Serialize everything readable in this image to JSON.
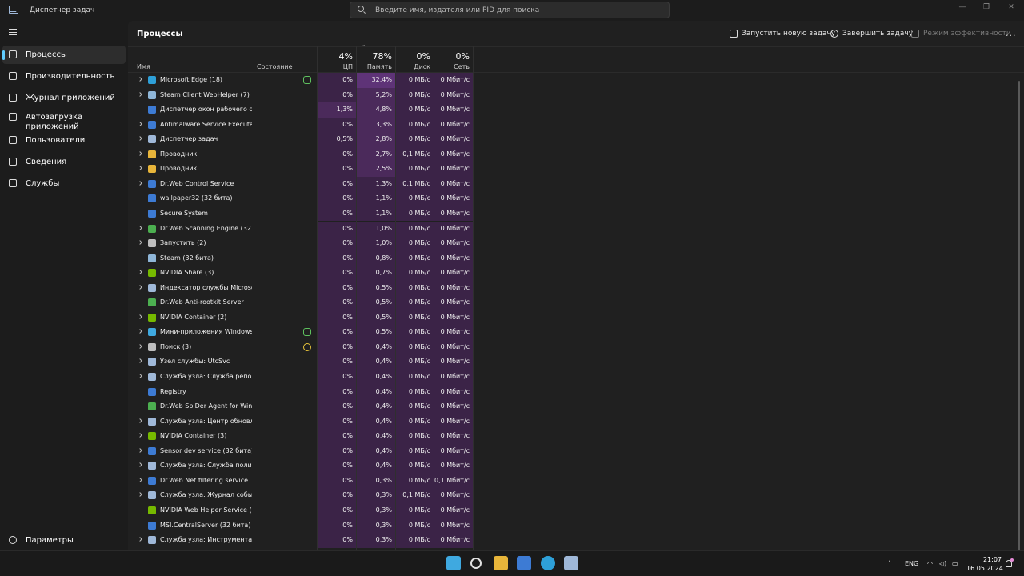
{
  "window": {
    "title": "Диспетчер задач"
  },
  "search": {
    "placeholder": "Введите имя, издателя или PID для поиска"
  },
  "sidebar": {
    "items": [
      {
        "label": "Процессы",
        "icon": "processes-icon",
        "active": true
      },
      {
        "label": "Производительность",
        "icon": "performance-icon",
        "active": false
      },
      {
        "label": "Журнал приложений",
        "icon": "app-history-icon",
        "active": false
      },
      {
        "label": "Автозагрузка приложений",
        "icon": "startup-apps-icon",
        "active": false
      },
      {
        "label": "Пользователи",
        "icon": "users-icon",
        "active": false
      },
      {
        "label": "Сведения",
        "icon": "details-icon",
        "active": false
      },
      {
        "label": "Службы",
        "icon": "services-icon",
        "active": false
      }
    ],
    "settings_label": "Параметры"
  },
  "toolbar": {
    "page_title": "Процессы",
    "run_task": "Запустить новую задачу",
    "end_task": "Завершить задачу",
    "efficiency": "Режим эффективности",
    "more": "..."
  },
  "columns": {
    "name": "Имя",
    "status": "Состояние",
    "cpu_pct": "4%",
    "cpu": "ЦП",
    "mem_pct": "78%",
    "mem": "Память",
    "disk_pct": "0%",
    "disk": "Диск",
    "net_pct": "0%",
    "net": "Сеть"
  },
  "colors": {
    "accent": "#60cdff",
    "heat_low": "#3b2347",
    "heat_mid": "#4b2a5b",
    "heat_high": "#5e3377",
    "status_green": "#5ec05e",
    "status_yellow": "#e7c33a"
  },
  "processes": [
    {
      "name": "Microsoft Edge (18)",
      "expand": true,
      "icon": "edge-icon",
      "iconColor": "#2ea0d8",
      "status": "leaf",
      "cpu": "0%",
      "mem": "32,4%",
      "disk": "0 МБ/с",
      "net": "0 Мбит/с",
      "cpuHeat": 0,
      "memHeat": 3
    },
    {
      "name": "Steam Client WebHelper (7)",
      "expand": true,
      "icon": "steam-icon",
      "iconColor": "#8fb6d8",
      "status": "",
      "cpu": "0%",
      "mem": "5,2%",
      "disk": "0 МБ/с",
      "net": "0 Мбит/с",
      "cpuHeat": 0,
      "memHeat": 2
    },
    {
      "name": "Диспетчер окон рабочего ст...",
      "expand": false,
      "icon": "window-manager-icon",
      "iconColor": "#3d7bd4",
      "status": "",
      "cpu": "1,3%",
      "mem": "4,8%",
      "disk": "0 МБ/с",
      "net": "0 Мбит/с",
      "cpuHeat": 2,
      "memHeat": 2
    },
    {
      "name": "Antimalware Service Executable",
      "expand": true,
      "icon": "defender-icon",
      "iconColor": "#3d7bd4",
      "status": "",
      "cpu": "0%",
      "mem": "3,3%",
      "disk": "0 МБ/с",
      "net": "0 Мбит/с",
      "cpuHeat": 0,
      "memHeat": 2
    },
    {
      "name": "Диспетчер задач",
      "expand": true,
      "icon": "task-manager-icon",
      "iconColor": "#9fb8d8",
      "status": "",
      "cpu": "0,5%",
      "mem": "2,8%",
      "disk": "0 МБ/с",
      "net": "0 Мбит/с",
      "cpuHeat": 1,
      "memHeat": 2
    },
    {
      "name": "Проводник",
      "expand": true,
      "icon": "folder-icon",
      "iconColor": "#e8b53a",
      "status": "",
      "cpu": "0%",
      "mem": "2,7%",
      "disk": "0,1 МБ/с",
      "net": "0 Мбит/с",
      "cpuHeat": 0,
      "memHeat": 2
    },
    {
      "name": "Проводник",
      "expand": true,
      "icon": "folder-icon",
      "iconColor": "#e8b53a",
      "status": "",
      "cpu": "0%",
      "mem": "2,5%",
      "disk": "0 МБ/с",
      "net": "0 Мбит/с",
      "cpuHeat": 0,
      "memHeat": 2
    },
    {
      "name": "Dr.Web Control Service",
      "expand": true,
      "icon": "service-icon",
      "iconColor": "#3d7bd4",
      "status": "",
      "cpu": "0%",
      "mem": "1,3%",
      "disk": "0,1 МБ/с",
      "net": "0 Мбит/с",
      "cpuHeat": 0,
      "memHeat": 1
    },
    {
      "name": "wallpaper32 (32 бита)",
      "expand": false,
      "icon": "wallpaper-icon",
      "iconColor": "#3d7bd4",
      "status": "",
      "cpu": "0%",
      "mem": "1,1%",
      "disk": "0 МБ/с",
      "net": "0 Мбит/с",
      "cpuHeat": 0,
      "memHeat": 1
    },
    {
      "name": "Secure System",
      "expand": false,
      "icon": "service-icon",
      "iconColor": "#3d7bd4",
      "status": "",
      "cpu": "0%",
      "mem": "1,1%",
      "disk": "0 МБ/с",
      "net": "0 Мбит/с",
      "cpuHeat": 0,
      "memHeat": 1
    },
    {
      "name": "Dr.Web Scanning Engine (32 б...",
      "expand": true,
      "icon": "drweb-icon",
      "iconColor": "#4caf50",
      "status": "",
      "cpu": "0%",
      "mem": "1,0%",
      "disk": "0 МБ/с",
      "net": "0 Мбит/с",
      "cpuHeat": 0,
      "memHeat": 1
    },
    {
      "name": "Запустить (2)",
      "expand": true,
      "icon": "run-icon",
      "iconColor": "#bdbdbd",
      "status": "",
      "cpu": "0%",
      "mem": "1,0%",
      "disk": "0 МБ/с",
      "net": "0 Мбит/с",
      "cpuHeat": 0,
      "memHeat": 1
    },
    {
      "name": "Steam (32 бита)",
      "expand": false,
      "icon": "steam-icon",
      "iconColor": "#8fb6d8",
      "status": "",
      "cpu": "0%",
      "mem": "0,8%",
      "disk": "0 МБ/с",
      "net": "0 Мбит/с",
      "cpuHeat": 0,
      "memHeat": 1
    },
    {
      "name": "NVIDIA Share (3)",
      "expand": true,
      "icon": "nvidia-icon",
      "iconColor": "#76b900",
      "status": "",
      "cpu": "0%",
      "mem": "0,7%",
      "disk": "0 МБ/с",
      "net": "0 Мбит/с",
      "cpuHeat": 0,
      "memHeat": 1
    },
    {
      "name": "Индексатор службы Microso...",
      "expand": true,
      "icon": "indexer-icon",
      "iconColor": "#9fb8d8",
      "status": "",
      "cpu": "0%",
      "mem": "0,5%",
      "disk": "0 МБ/с",
      "net": "0 Мбит/с",
      "cpuHeat": 0,
      "memHeat": 1
    },
    {
      "name": "Dr.Web Anti-rootkit Server",
      "expand": false,
      "icon": "drweb-icon",
      "iconColor": "#4caf50",
      "status": "",
      "cpu": "0%",
      "mem": "0,5%",
      "disk": "0 МБ/с",
      "net": "0 Мбит/с",
      "cpuHeat": 0,
      "memHeat": 1
    },
    {
      "name": "NVIDIA Container (2)",
      "expand": true,
      "icon": "nvidia-icon",
      "iconColor": "#76b900",
      "status": "",
      "cpu": "0%",
      "mem": "0,5%",
      "disk": "0 МБ/с",
      "net": "0 Мбит/с",
      "cpuHeat": 0,
      "memHeat": 1
    },
    {
      "name": "Мини-приложения Windows...",
      "expand": true,
      "icon": "widgets-icon",
      "iconColor": "#3fa9e0",
      "status": "leaf",
      "cpu": "0%",
      "mem": "0,5%",
      "disk": "0 МБ/с",
      "net": "0 Мбит/с",
      "cpuHeat": 0,
      "memHeat": 1
    },
    {
      "name": "Поиск (3)",
      "expand": true,
      "icon": "search-process-icon",
      "iconColor": "#bdbdbd",
      "status": "pause",
      "cpu": "0%",
      "mem": "0,4%",
      "disk": "0 МБ/с",
      "net": "0 Мбит/с",
      "cpuHeat": 0,
      "memHeat": 1
    },
    {
      "name": "Узел службы: UtcSvc",
      "expand": true,
      "icon": "gear-service-icon",
      "iconColor": "#9fb8d8",
      "status": "",
      "cpu": "0%",
      "mem": "0,4%",
      "disk": "0 МБ/с",
      "net": "0 Мбит/с",
      "cpuHeat": 0,
      "memHeat": 1
    },
    {
      "name": "Служба узла: Служба репоз...",
      "expand": true,
      "icon": "gear-service-icon",
      "iconColor": "#9fb8d8",
      "status": "",
      "cpu": "0%",
      "mem": "0,4%",
      "disk": "0 МБ/с",
      "net": "0 Мбит/с",
      "cpuHeat": 0,
      "memHeat": 1
    },
    {
      "name": "Registry",
      "expand": false,
      "icon": "service-icon",
      "iconColor": "#3d7bd4",
      "status": "",
      "cpu": "0%",
      "mem": "0,4%",
      "disk": "0 МБ/с",
      "net": "0 Мбит/с",
      "cpuHeat": 0,
      "memHeat": 1
    },
    {
      "name": "Dr.Web SplDer Agent for Wind...",
      "expand": false,
      "icon": "drweb-icon",
      "iconColor": "#4caf50",
      "status": "",
      "cpu": "0%",
      "mem": "0,4%",
      "disk": "0 МБ/с",
      "net": "0 Мбит/с",
      "cpuHeat": 0,
      "memHeat": 1
    },
    {
      "name": "Служба узла: Центр обновле...",
      "expand": true,
      "icon": "gear-service-icon",
      "iconColor": "#9fb8d8",
      "status": "",
      "cpu": "0%",
      "mem": "0,4%",
      "disk": "0 МБ/с",
      "net": "0 Мбит/с",
      "cpuHeat": 0,
      "memHeat": 1
    },
    {
      "name": "NVIDIA Container (3)",
      "expand": true,
      "icon": "nvidia-icon",
      "iconColor": "#76b900",
      "status": "",
      "cpu": "0%",
      "mem": "0,4%",
      "disk": "0 МБ/с",
      "net": "0 Мбит/с",
      "cpuHeat": 0,
      "memHeat": 1
    },
    {
      "name": "Sensor dev service (32 бита)",
      "expand": true,
      "icon": "service-icon",
      "iconColor": "#3d7bd4",
      "status": "",
      "cpu": "0%",
      "mem": "0,4%",
      "disk": "0 МБ/с",
      "net": "0 Мбит/с",
      "cpuHeat": 0,
      "memHeat": 1
    },
    {
      "name": "Служба узла: Служба полит...",
      "expand": true,
      "icon": "gear-service-icon",
      "iconColor": "#9fb8d8",
      "status": "",
      "cpu": "0%",
      "mem": "0,4%",
      "disk": "0 МБ/с",
      "net": "0 Мбит/с",
      "cpuHeat": 0,
      "memHeat": 1
    },
    {
      "name": "Dr.Web Net filtering service",
      "expand": true,
      "icon": "service-icon",
      "iconColor": "#3d7bd4",
      "status": "",
      "cpu": "0%",
      "mem": "0,3%",
      "disk": "0 МБ/с",
      "net": "0,1 Мбит/с",
      "cpuHeat": 0,
      "memHeat": 1
    },
    {
      "name": "Служба узла: Журнал событ...",
      "expand": true,
      "icon": "gear-service-icon",
      "iconColor": "#9fb8d8",
      "status": "",
      "cpu": "0%",
      "mem": "0,3%",
      "disk": "0,1 МБ/с",
      "net": "0 Мбит/с",
      "cpuHeat": 0,
      "memHeat": 1
    },
    {
      "name": "NVIDIA Web Helper Service (3...",
      "expand": false,
      "icon": "nvidia-icon",
      "iconColor": "#76b900",
      "status": "",
      "cpu": "0%",
      "mem": "0,3%",
      "disk": "0 МБ/с",
      "net": "0 Мбит/с",
      "cpuHeat": 0,
      "memHeat": 1
    },
    {
      "name": "MSI.CentralServer (32 бита)",
      "expand": false,
      "icon": "service-icon",
      "iconColor": "#3d7bd4",
      "status": "",
      "cpu": "0%",
      "mem": "0,3%",
      "disk": "0 МБ/с",
      "net": "0 Мбит/с",
      "cpuHeat": 0,
      "memHeat": 1
    },
    {
      "name": "Служба узла: Инструментар...",
      "expand": true,
      "icon": "gear-service-icon",
      "iconColor": "#9fb8d8",
      "status": "",
      "cpu": "0%",
      "mem": "0,3%",
      "disk": "0 МБ/с",
      "net": "0 Мбит/с",
      "cpuHeat": 0,
      "memHeat": 1
    }
  ],
  "taskbar": {
    "apps": [
      {
        "name": "start-icon",
        "color": "#3fa9e0"
      },
      {
        "name": "search-icon",
        "color": "#e0e0e0"
      },
      {
        "name": "file-explorer-icon",
        "color": "#e8b53a"
      },
      {
        "name": "store-icon",
        "color": "#3d7bd4"
      },
      {
        "name": "edge-icon",
        "color": "#2ea0d8"
      },
      {
        "name": "task-manager-icon",
        "color": "#9fb8d8"
      }
    ],
    "lang": "ENG",
    "time": "21:07",
    "date": "16.05.2024"
  }
}
